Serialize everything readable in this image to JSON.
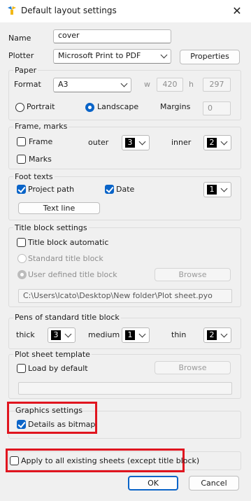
{
  "window": {
    "title": "Default layout settings",
    "close": "✕"
  },
  "name": {
    "label": "Name",
    "value": "cover"
  },
  "plotter": {
    "label": "Plotter",
    "value": "Microsoft Print to PDF",
    "properties_button": "Properties"
  },
  "paper": {
    "group_title": "Paper",
    "format_label": "Format",
    "format_value": "A3",
    "w_label": "w",
    "w_value": "420",
    "h_label": "h",
    "h_value": "297",
    "portrait_label": "Portrait",
    "landscape_label": "Landscape",
    "orientation": "landscape",
    "margins_label": "Margins",
    "margins_value": "0"
  },
  "frame_marks": {
    "group_title": "Frame, marks",
    "frame_label": "Frame",
    "frame_checked": false,
    "outer_label": "outer",
    "outer_pen": "3",
    "inner_label": "inner",
    "inner_pen": "2",
    "marks_label": "Marks",
    "marks_checked": false
  },
  "foot_texts": {
    "group_title": "Foot texts",
    "project_path_label": "Project path",
    "project_path_checked": true,
    "date_label": "Date",
    "date_checked": true,
    "pen": "1",
    "text_line_button": "Text line"
  },
  "title_block": {
    "group_title": "Title block settings",
    "automatic_label": "Title block automatic",
    "automatic_checked": false,
    "standard_label": "Standard title block",
    "user_defined_label": "User defined title block",
    "browse_button": "Browse",
    "path_value": "C:\\Users\\lcato\\Desktop\\New folder\\Plot sheet.pyo"
  },
  "pens_standard": {
    "group_title": "Pens of standard title block",
    "thick_label": "thick",
    "thick_pen": "3",
    "medium_label": "medium",
    "medium_pen": "1",
    "thin_label": "thin",
    "thin_pen": "2"
  },
  "plot_template": {
    "group_title": "Plot sheet template",
    "load_default_label": "Load by default",
    "load_default_checked": false,
    "browse_button": "Browse",
    "path_value": ""
  },
  "graphics": {
    "group_title": "Graphics settings",
    "bitmap_label": "Details as bitmap",
    "bitmap_checked": true
  },
  "apply_all": {
    "label": "Apply to all existing sheets (except title block)",
    "checked": false
  },
  "buttons": {
    "ok": "OK",
    "cancel": "Cancel"
  },
  "colors": {
    "accent": "#0a64c8",
    "highlight": "#e0151f"
  }
}
